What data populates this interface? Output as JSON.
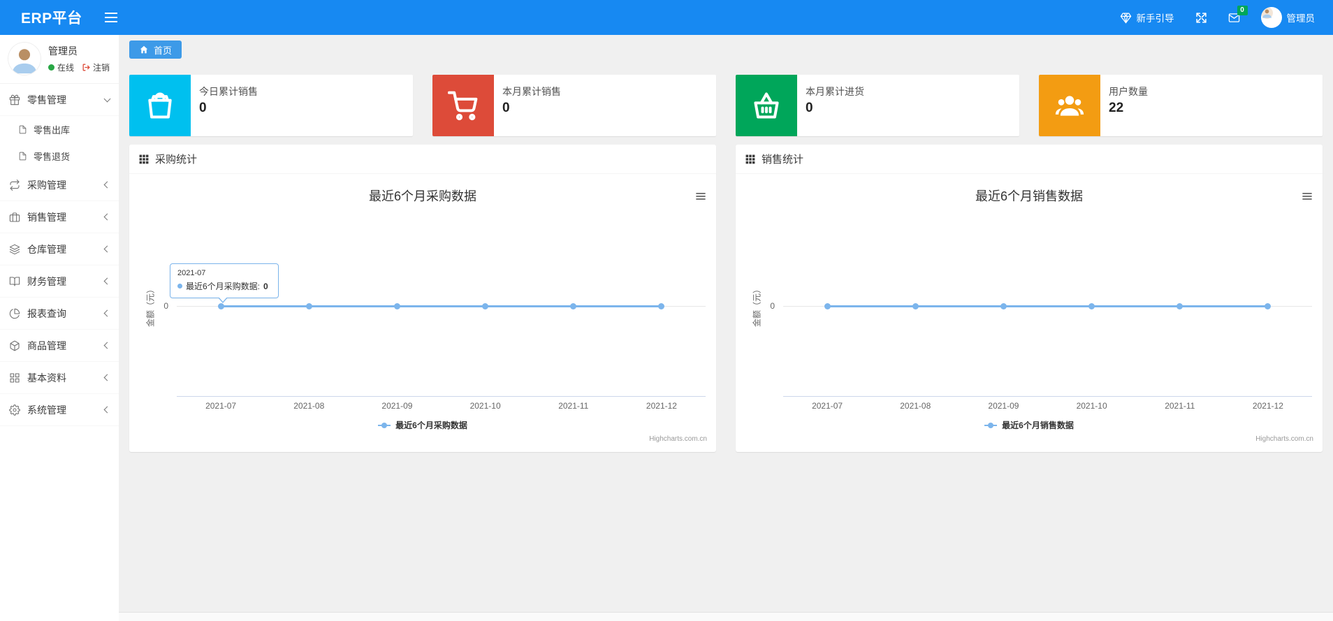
{
  "theme": {
    "header_bg": "#1789f2",
    "tab_bg": "#3d9ae8",
    "badge_green": "#00a65a",
    "online_green": "#28a745",
    "logout_red": "#dd4b39"
  },
  "header": {
    "brand": "ERP平台",
    "guide": "新手引导",
    "mail_badge": "0",
    "user": "管理员"
  },
  "sidebar": {
    "user": {
      "name": "管理员",
      "status": "在线",
      "logout": "注销"
    },
    "menu": [
      {
        "label": "零售管理",
        "icon": "gift-icon",
        "state": "expanded",
        "children": [
          {
            "label": "零售出库",
            "icon": "file-icon"
          },
          {
            "label": "零售退货",
            "icon": "file-icon"
          }
        ]
      },
      {
        "label": "采购管理",
        "icon": "repeat-icon"
      },
      {
        "label": "销售管理",
        "icon": "briefcase-icon"
      },
      {
        "label": "仓库管理",
        "icon": "layers-icon"
      },
      {
        "label": "财务管理",
        "icon": "book-open-icon"
      },
      {
        "label": "报表查询",
        "icon": "pie-chart-icon"
      },
      {
        "label": "商品管理",
        "icon": "box-icon"
      },
      {
        "label": "基本资料",
        "icon": "grid-icon"
      },
      {
        "label": "系统管理",
        "icon": "gear-icon"
      }
    ]
  },
  "breadcrumb": {
    "home": "首页"
  },
  "cards": [
    {
      "label": "今日累计销售",
      "value": "0",
      "color": "#00c0ef",
      "icon": "shopping-bag-icon"
    },
    {
      "label": "本月累计销售",
      "value": "0",
      "color": "#dd4b39",
      "icon": "shopping-cart-icon"
    },
    {
      "label": "本月累计进货",
      "value": "0",
      "color": "#00a65a",
      "icon": "shopping-basket-icon"
    },
    {
      "label": "用户数量",
      "value": "22",
      "color": "#f39c12",
      "icon": "users-icon"
    }
  ],
  "panels": [
    {
      "title": "采购统计"
    },
    {
      "title": "销售统计"
    }
  ],
  "chart_data": [
    {
      "type": "line",
      "title": "最近6个月采购数据",
      "categories": [
        "2021-07",
        "2021-08",
        "2021-09",
        "2021-10",
        "2021-11",
        "2021-12"
      ],
      "series": [
        {
          "name": "最近6个月采购数据",
          "values": [
            0,
            0,
            0,
            0,
            0,
            0
          ]
        }
      ],
      "xlabel": "",
      "ylabel": "金额（元）",
      "yticks": [
        "0"
      ],
      "line_color": "#7cb5ec",
      "grid": false,
      "legend_position": "bottom",
      "credits": "Highcharts.com.cn",
      "tooltip": {
        "header": "2021-07",
        "label": "最近6个月采购数据:",
        "value": "0"
      }
    },
    {
      "type": "line",
      "title": "最近6个月销售数据",
      "categories": [
        "2021-07",
        "2021-08",
        "2021-09",
        "2021-10",
        "2021-11",
        "2021-12"
      ],
      "series": [
        {
          "name": "最近6个月销售数据",
          "values": [
            0,
            0,
            0,
            0,
            0,
            0
          ]
        }
      ],
      "xlabel": "",
      "ylabel": "金额（元）",
      "yticks": [
        "0"
      ],
      "line_color": "#7cb5ec",
      "grid": false,
      "legend_position": "bottom",
      "credits": "Highcharts.com.cn"
    }
  ]
}
